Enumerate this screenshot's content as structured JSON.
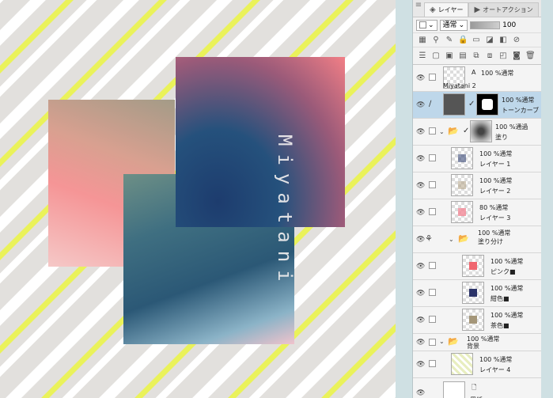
{
  "canvas": {
    "signature": "Miyatani",
    "colors": {
      "background": "#e2e0dd",
      "stripe_white": "#ffffff",
      "stripe_yellow": "#eaf25a"
    }
  },
  "panel": {
    "tabs": [
      {
        "label": "レイヤー",
        "icon": "layers-icon"
      },
      {
        "label": "オートアクション",
        "icon": "auto-action-icon"
      }
    ],
    "blend_mode": "通常",
    "opacity": "100",
    "layers": [
      {
        "name": "Miyatani 2",
        "meta": "100 %通常"
      },
      {
        "name": "トーンカーブ 1",
        "meta": "100 %通常"
      },
      {
        "name": "塗り",
        "meta": "100 %通過"
      },
      {
        "name": "レイヤー 1",
        "meta": "100 %通常"
      },
      {
        "name": "レイヤー 2",
        "meta": "100 %通常"
      },
      {
        "name": "レイヤー 3",
        "meta": "80 %通常"
      },
      {
        "name": "塗り分け",
        "meta": "100 %通常"
      },
      {
        "name": "ピンク■",
        "meta": "100 %通常"
      },
      {
        "name": "紺色■",
        "meta": "100 %通常"
      },
      {
        "name": "茶色■",
        "meta": "100 %通常"
      },
      {
        "name": "背景",
        "meta": "100 %通常"
      },
      {
        "name": "レイヤー 4",
        "meta": "100 %通常"
      },
      {
        "name": "用紙",
        "meta": ""
      }
    ]
  }
}
